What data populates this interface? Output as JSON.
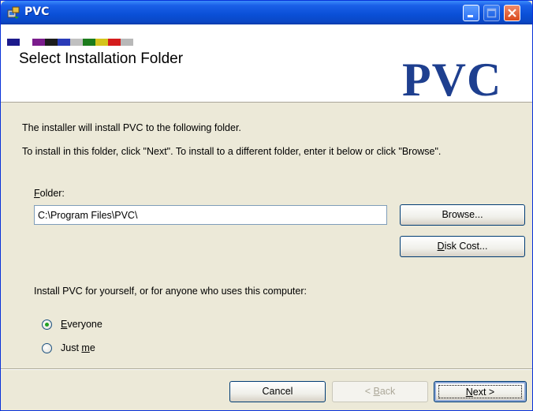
{
  "window": {
    "title": "PVC"
  },
  "header": {
    "title": "Select Installation Folder",
    "logo_text": "PVC",
    "color_strip": [
      "#1c1a8c",
      "#ffffff",
      "#7a1c8c",
      "#1c1c1c",
      "#2a3bb8",
      "#c0c0c0",
      "#1c7c1c",
      "#d4c41c",
      "#d41c1c",
      "#b8b8b8"
    ]
  },
  "body": {
    "line1": "The installer will install PVC to the following folder.",
    "line2": "To install in this folder, click \"Next\". To install to a different folder, enter it below or click \"Browse\".",
    "folder_label_pre": "",
    "folder_label_key": "F",
    "folder_label_post": "older:",
    "folder_value": "C:\\Program Files\\PVC\\",
    "browse_label": "Browse...",
    "disk_cost_pre": "",
    "disk_cost_key": "D",
    "disk_cost_post": "isk Cost...",
    "install_for_label": "Install PVC for yourself, or for anyone who uses this computer:",
    "everyone_key": "E",
    "everyone_post": "veryone",
    "justme_pre": "Just ",
    "justme_key": "m",
    "justme_post": "e",
    "selected_option": "Everyone"
  },
  "footer": {
    "cancel_label": "Cancel",
    "back_pre": "< ",
    "back_key": "B",
    "back_post": "ack",
    "next_key": "N",
    "next_post": "ext >"
  }
}
